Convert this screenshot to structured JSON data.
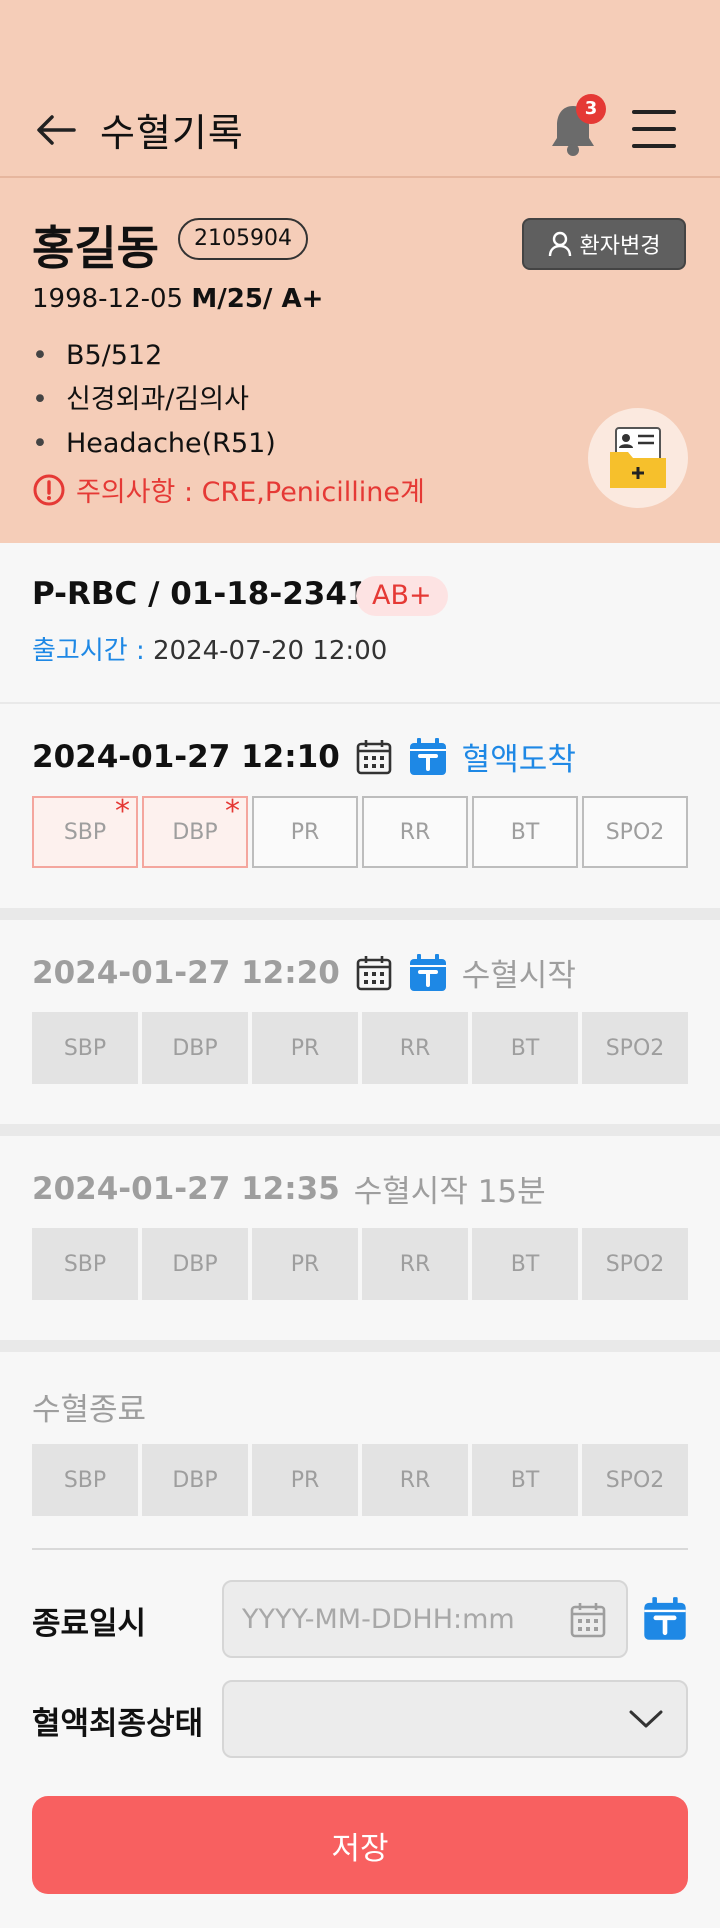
{
  "header": {
    "title": "수혈기록",
    "notification_count": "3"
  },
  "patient": {
    "name": "홍길동",
    "id": "2105904",
    "change_label": "환자변경",
    "dob": "1998-12-05",
    "sex_age_blood": "M/25/ A+",
    "bullets": [
      "B5/512",
      "신경외과/김의사",
      "Headache(R51)"
    ],
    "caution": "주의사항 : CRE,Penicilline계"
  },
  "product": {
    "code": "P-RBC / 01-18-23413",
    "abo": "AB+",
    "release_label": "출고시간 :",
    "release_time": "2024-07-20  12:00"
  },
  "records": [
    {
      "datetime": "2024-01-27 12:10",
      "status": "혈액도착"
    },
    {
      "datetime": "2024-01-27 12:20",
      "status": "수혈시작"
    },
    {
      "datetime": "2024-01-27 12:35",
      "status": "수혈시작 15분"
    }
  ],
  "end_label": "수혈종료",
  "vitals": [
    "SBP",
    "DBP",
    "PR",
    "RR",
    "BT",
    "SPO2"
  ],
  "form": {
    "end_datetime_label": "종료일시",
    "end_datetime_placeholder": "YYYY-MM-DDHH:mm",
    "final_status_label": "혈액최종상태",
    "save_label": "저장"
  },
  "colors": {
    "header_bg": "#f5cdb8",
    "accent_blue": "#1e88e5",
    "alert_red": "#e53935",
    "save_button": "#f86060"
  }
}
